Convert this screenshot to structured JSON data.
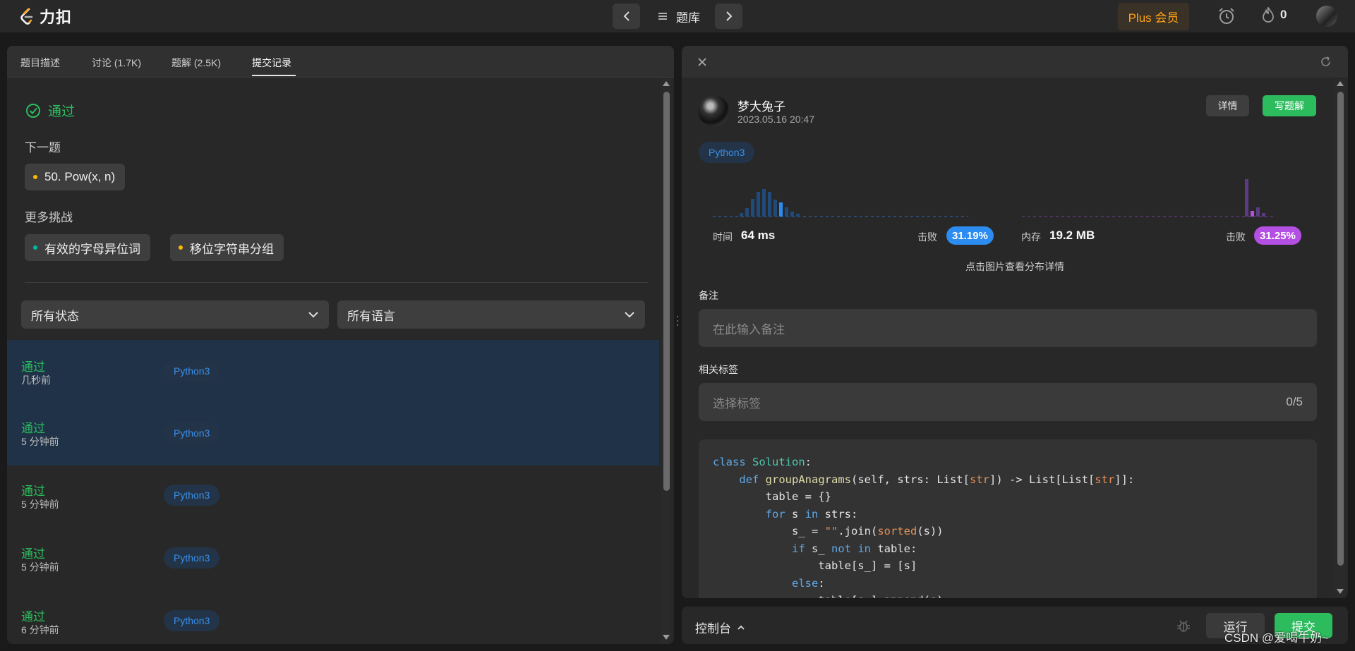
{
  "colors": {
    "accent_green": "#2cbb5d",
    "blue": "#3a8ee6",
    "orange": "#ffa116",
    "purple": "#b44fe4"
  },
  "topnav": {
    "logo_text": "力扣",
    "problem_list_label": "题库",
    "plus_label": "Plus 会员",
    "streak_count": "0",
    "icons": [
      "prev-icon",
      "list-icon",
      "next-icon",
      "alarm-icon",
      "fire-icon"
    ]
  },
  "left": {
    "tabs": [
      {
        "label": "题目描述"
      },
      {
        "label": "讨论 (1.7K)"
      },
      {
        "label": "题解 (2.5K)"
      },
      {
        "label": "提交记录"
      }
    ],
    "result": "通过",
    "next_label": "下一题",
    "next_problem": "50. Pow(x, n)",
    "more_label": "更多挑战",
    "challenges": [
      "有效的字母异位词",
      "移位字符串分组"
    ],
    "filter_status": "所有状态",
    "filter_language": "所有语言",
    "submissions": [
      {
        "status": "通过",
        "time": "几秒前",
        "lang": "Python3"
      },
      {
        "status": "通过",
        "time": "5 分钟前",
        "lang": "Python3"
      },
      {
        "status": "通过",
        "time": "5 分钟前",
        "lang": "Python3"
      },
      {
        "status": "通过",
        "time": "5 分钟前",
        "lang": "Python3"
      },
      {
        "status": "通过",
        "time": "6 分钟前",
        "lang": "Python3"
      }
    ]
  },
  "right": {
    "user_name": "梦大兔子",
    "date": "2023.05.16 20:47",
    "detail_button": "详情",
    "write_button": "写题解",
    "lang": "Python3",
    "runtime_label": "时间",
    "runtime_value": "64 ms",
    "runtime_beat_label": "击败",
    "runtime_beat": "31.19%",
    "memory_label": "内存",
    "memory_value": "19.2 MB",
    "memory_beat_label": "击败",
    "memory_beat": "31.25%",
    "hint": "点击图片查看分布详情",
    "note_label": "备注",
    "note_placeholder": "在此输入备注",
    "tags_label": "相关标签",
    "tags_placeholder": "选择标签",
    "tags_count": "0/5"
  },
  "console": {
    "label": "控制台",
    "run_label": "运行",
    "submit_label": "提交"
  },
  "watermark": "CSDN @爱喝牛奶~"
}
